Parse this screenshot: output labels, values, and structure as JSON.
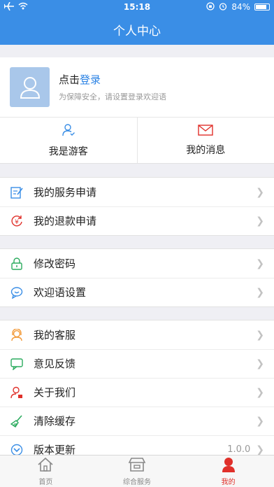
{
  "status_bar": {
    "time": "15:18",
    "battery": "84%",
    "battery_level": 0.84
  },
  "navbar": {
    "title": "个人中心"
  },
  "profile": {
    "prefix": "点击",
    "login": "登录",
    "subtitle": "为保障安全，请设置登录欢迎语"
  },
  "quick": [
    {
      "label": "我是游客",
      "icon": "guest-icon"
    },
    {
      "label": "我的消息",
      "icon": "mail-icon"
    }
  ],
  "groups": [
    [
      {
        "label": "我的服务申请",
        "icon": "edit-form-icon"
      },
      {
        "label": "我的退款申请",
        "icon": "yen-refund-icon"
      }
    ],
    [
      {
        "label": "修改密码",
        "icon": "lock-icon"
      },
      {
        "label": "欢迎语设置",
        "icon": "chat-bubble-icon"
      }
    ],
    [
      {
        "label": "我的客服",
        "icon": "customer-service-icon"
      },
      {
        "label": "意见反馈",
        "icon": "feedback-icon"
      },
      {
        "label": "关于我们",
        "icon": "about-us-icon"
      },
      {
        "label": "清除缓存",
        "icon": "broom-icon"
      },
      {
        "label": "版本更新",
        "icon": "update-icon",
        "value": "1.0.0"
      }
    ]
  ],
  "tabs": [
    {
      "label": "首页",
      "icon": "home-icon",
      "active": false
    },
    {
      "label": "综合服务",
      "icon": "store-icon",
      "active": false
    },
    {
      "label": "我的",
      "icon": "person-icon",
      "active": true
    }
  ],
  "colors": {
    "primary": "#3a8ee6",
    "link": "#2a82e4",
    "active_tab": "#e0302a"
  }
}
